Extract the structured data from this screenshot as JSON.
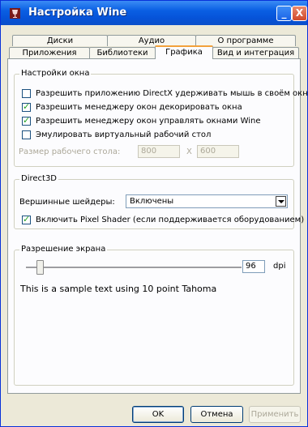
{
  "window": {
    "title": "Настройка Wine",
    "minimize": "_",
    "close": "X"
  },
  "tabs_row1": [
    "Диски",
    "Аудио",
    "О программе"
  ],
  "tabs_row2": [
    "Приложения",
    "Библиотеки",
    "Графика",
    "Вид и интеграция"
  ],
  "active_tab": "Графика",
  "window_settings": {
    "title": "Настройки окна",
    "options": [
      {
        "label": "Разрешить приложению DirectX удерживать мышь в своём окне",
        "checked": false
      },
      {
        "label": "Разрешить менеджеру окон декорировать окна",
        "checked": true
      },
      {
        "label": "Разрешить менеджеру окон управлять окнами Wine",
        "checked": true
      },
      {
        "label": "Эмулировать виртуальный рабочий стол",
        "checked": false
      }
    ],
    "desktop_size_label": "Размер рабочего стола:",
    "width": "800",
    "sep": "X",
    "height": "600"
  },
  "direct3d": {
    "title": "Direct3D",
    "vertex_label": "Вершинные шейдеры:",
    "vertex_value": "Включены",
    "pixel_shader_label": "Включить Pixel Shader (если поддерживается оборудованием)",
    "pixel_shader_checked": true
  },
  "resolution": {
    "title": "Разрешение экрана",
    "dpi_value": "96",
    "dpi_unit": "dpi",
    "sample_text": "This is a sample text using 10 point Tahoma",
    "slider_fraction": 0.05
  },
  "buttons": {
    "ok": "OK",
    "cancel": "Отмена",
    "apply": "Применить"
  }
}
